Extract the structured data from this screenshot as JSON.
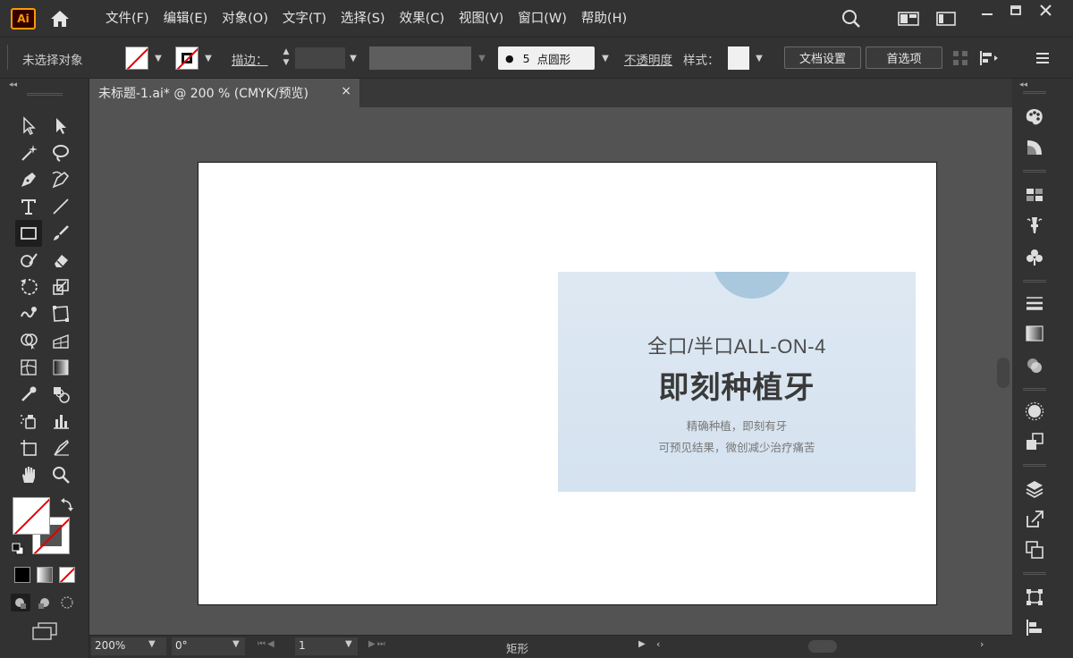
{
  "app": {
    "logo_text": "Ai"
  },
  "menu": [
    "文件(F)",
    "编辑(E)",
    "对象(O)",
    "文字(T)",
    "选择(S)",
    "效果(C)",
    "视图(V)",
    "窗口(W)",
    "帮助(H)"
  ],
  "control": {
    "selection_status": "未选择对象",
    "stroke_label": "描边：",
    "brush_dot": "●",
    "brush_size": "5",
    "brush_name": "点圆形",
    "opacity_label": "不透明度",
    "style_label": "样式：",
    "doc_setup": "文档设置",
    "preferences": "首选项"
  },
  "document": {
    "tab_title": "未标题-1.ai* @ 200 % (CMYK/预览)",
    "close_glyph": "×"
  },
  "banner": {
    "line1": "全口/半口ALL-ON-4",
    "line2": "即刻种植牙",
    "line3": "精确种植，即刻有牙",
    "line4": "可预见结果，微创减少治疗痛苦"
  },
  "status": {
    "zoom": "200%",
    "rotation": "0°",
    "artboard_num": "1",
    "tool_name": "矩形"
  },
  "colors": {
    "accent": "#ff9a00",
    "none_slash": "#e00000",
    "banner_bg": "#dde8f3"
  }
}
